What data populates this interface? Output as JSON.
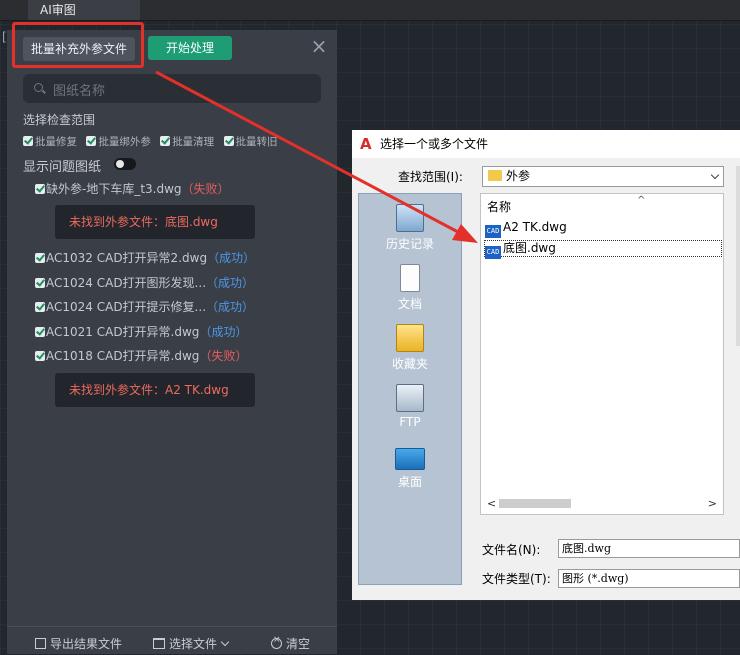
{
  "app": {
    "tab_title": "AI审图",
    "bracket": "["
  },
  "panel": {
    "supplement_button": "批量补充外参文件",
    "start_button": "开始处理",
    "close_glyph": "×",
    "search_placeholder": "图纸名称",
    "scope_label": "选择检查范围",
    "scope_options": [
      "批量修复",
      "批量绑外参",
      "批量清理",
      "批量转旧"
    ],
    "show_issues_label": "显示问题图纸",
    "files": [
      {
        "name": "缺外参-地下车库_t3.dwg",
        "status": "（失败）",
        "error": "未找到外参文件：底图.dwg"
      },
      {
        "name": "AC1032 CAD打开异常2.dwg",
        "status": "（成功）"
      },
      {
        "name": "AC1024 CAD打开图形发现...",
        "status": "（成功）"
      },
      {
        "name": "AC1024 CAD打开提示修复...",
        "status": "（成功）"
      },
      {
        "name": "AC1021 CAD打开异常.dwg",
        "status": "（成功）"
      },
      {
        "name": "AC1018 CAD打开异常.dwg",
        "status": "（失败）",
        "error": "未找到外参文件：A2 TK.dwg"
      }
    ],
    "bottom": {
      "export": "导出结果文件",
      "select": "选择文件",
      "clear": "清空"
    }
  },
  "dialog": {
    "title": "选择一个或多个文件",
    "logo": "A",
    "look_in_label": "查找范围(I):",
    "look_in_value": "外参",
    "places": [
      "历史记录",
      "文档",
      "收藏夹",
      "FTP",
      "桌面"
    ],
    "column_name": "名称",
    "sort_caret": "^",
    "files": [
      {
        "name": "A2 TK.dwg",
        "icon_text": "CAD"
      },
      {
        "name": "底图.dwg",
        "icon_text": "CAD"
      }
    ],
    "scroll_left": "<",
    "scroll_right": ">",
    "filename_label": "文件名(N):",
    "filename_value": "底图.dwg",
    "filetype_label": "文件类型(T):",
    "filetype_value": "图形 (*.dwg)"
  },
  "colors": {
    "annotation_red": "#e3302a",
    "success": "#4d96e6",
    "fail": "#e65c5c",
    "start_green": "#1e9c74"
  }
}
